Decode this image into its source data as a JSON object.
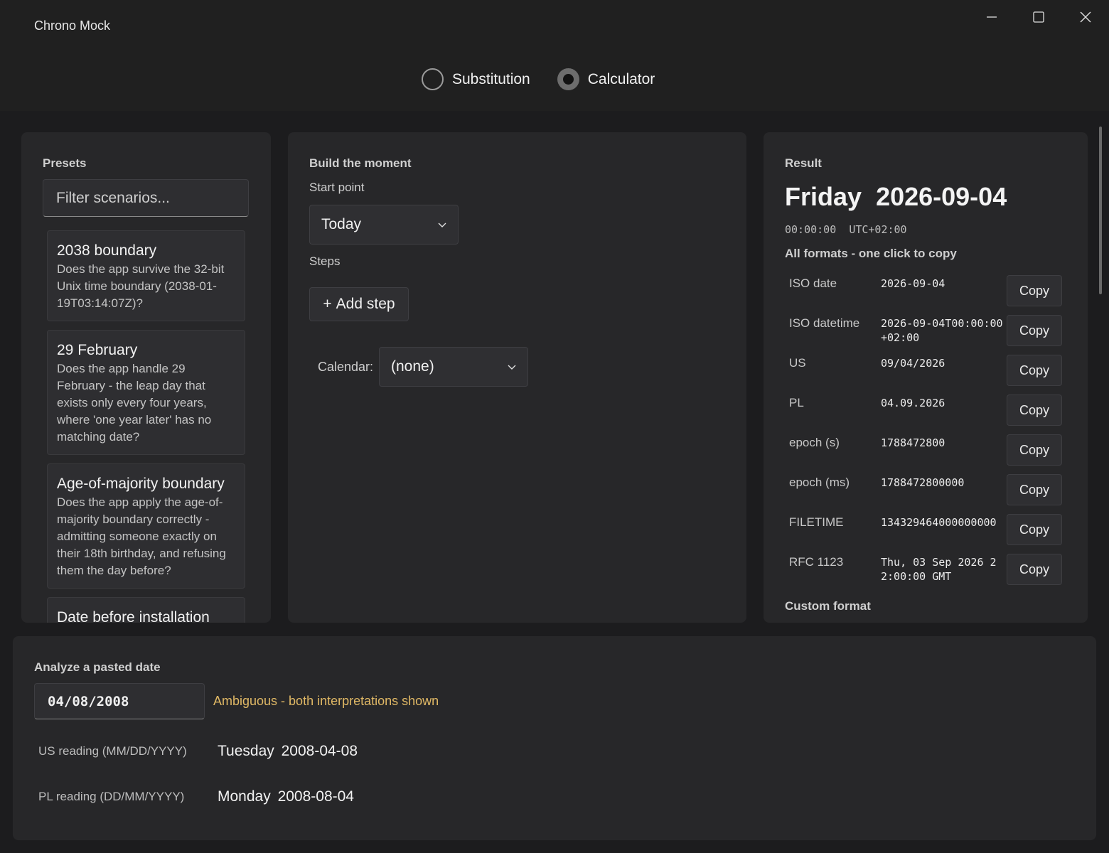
{
  "app": {
    "title": "Chrono Mock"
  },
  "modes": [
    {
      "label": "Substitution",
      "selected": false
    },
    {
      "label": "Calculator",
      "selected": true
    }
  ],
  "presets": {
    "title": "Presets",
    "filter_placeholder": "Filter scenarios...",
    "items": [
      {
        "title": "2038 boundary",
        "description": "Does the app survive the 32-bit Unix time boundary (2038-01-19T03:14:07Z)?"
      },
      {
        "title": "29 February",
        "description": "Does the app handle 29 February - the leap day that exists only every four years, where 'one year later' has no matching date?"
      },
      {
        "title": "Age-of-majority boundary",
        "description": "Does the app apply the age-of-majority boundary correctly - admitting someone exactly on their 18th birthday, and refusing them the day before?"
      },
      {
        "title": "Date before installation",
        "description": ""
      }
    ]
  },
  "builder": {
    "title": "Build the moment",
    "start_point_label": "Start point",
    "start_point_value": "Today",
    "steps_label": "Steps",
    "add_step_label": "Add step",
    "calendar_label": "Calendar:",
    "calendar_value": "(none)"
  },
  "result": {
    "title": "Result",
    "day": "Friday",
    "date": "2026-09-04",
    "time": "00:00:00",
    "offset": "UTC+02:00",
    "formats_heading": "All formats - one click to copy",
    "copy_label": "Copy",
    "formats": [
      {
        "name": "ISO date",
        "value": "2026-09-04"
      },
      {
        "name": "ISO datetime",
        "value": "2026-09-04T00:00:00+02:00"
      },
      {
        "name": "US",
        "value": "09/04/2026"
      },
      {
        "name": "PL",
        "value": "04.09.2026"
      },
      {
        "name": "epoch (s)",
        "value": "1788472800"
      },
      {
        "name": "epoch (ms)",
        "value": "1788472800000"
      },
      {
        "name": "FILETIME",
        "value": "134329464000000000"
      },
      {
        "name": "RFC 1123",
        "value": "Thu, 03 Sep 2026 22:00:00 GMT"
      }
    ],
    "custom_format_heading": "Custom format"
  },
  "analyze": {
    "title": "Analyze a pasted date",
    "input_value": "04/08/2008",
    "status": "Ambiguous - both interpretations shown",
    "readings": [
      {
        "label": "US reading (MM/DD/YYYY)",
        "day": "Tuesday",
        "date": "2008-04-08"
      },
      {
        "label": "PL reading (DD/MM/YYYY)",
        "day": "Monday",
        "date": "2008-08-04"
      }
    ]
  },
  "colors": {
    "background": "#1c1c1e",
    "panel": "#272729",
    "warning": "#e0b865"
  }
}
